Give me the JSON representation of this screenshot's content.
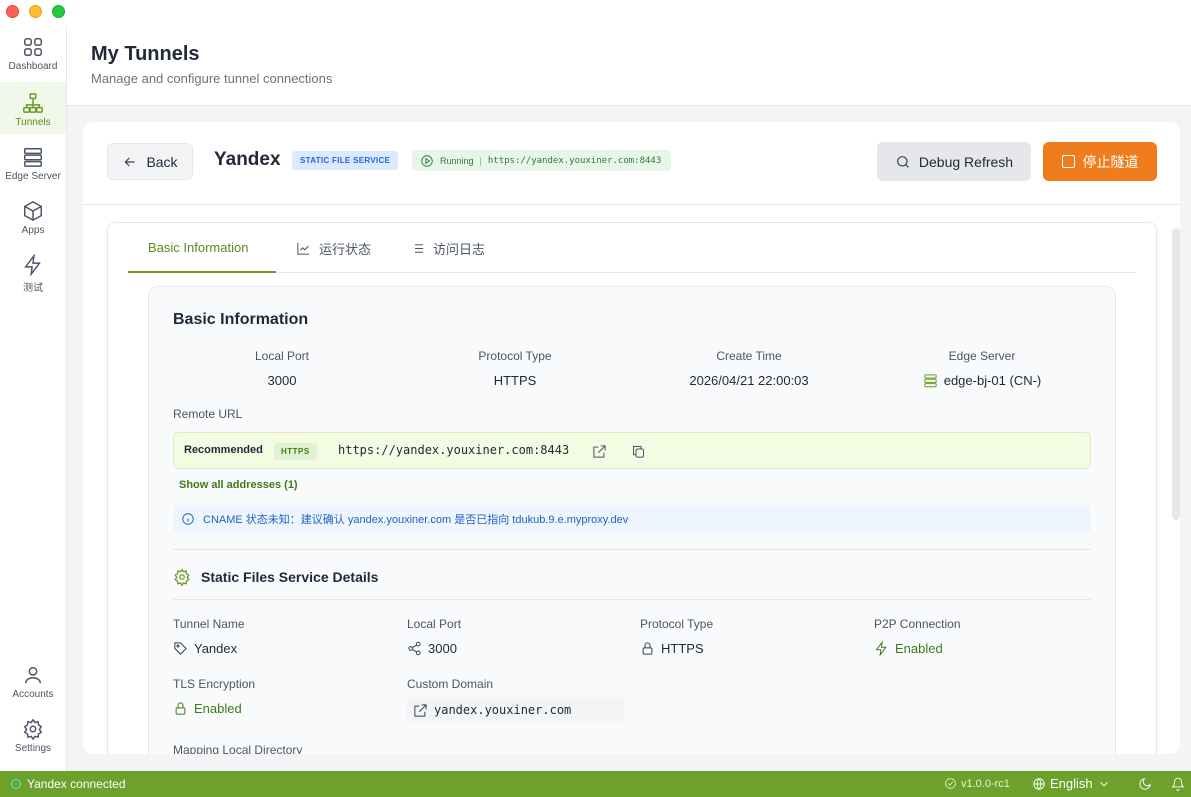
{
  "sidebar": {
    "items": [
      {
        "label": "Dashboard",
        "icon": "grid-icon"
      },
      {
        "label": "Tunnels",
        "icon": "network-icon"
      },
      {
        "label": "Edge Server",
        "icon": "server-icon"
      },
      {
        "label": "Apps",
        "icon": "box-icon"
      },
      {
        "label": "测试",
        "icon": "lightning-icon"
      }
    ],
    "bottom": [
      {
        "label": "Accounts",
        "icon": "user-icon"
      },
      {
        "label": "Settings",
        "icon": "gear-icon"
      }
    ]
  },
  "header": {
    "title": "My Tunnels",
    "subtitle": "Manage and configure tunnel connections"
  },
  "toolbar": {
    "back_label": "Back",
    "tunnel_name": "Yandex",
    "service_badge": "STATIC FILE SERVICE",
    "status_label": "Running",
    "status_sep": "|",
    "status_url": "https://yandex.youxiner.com:8443",
    "debug_label": "Debug Refresh",
    "stop_label": "停止隧道"
  },
  "tabs": [
    {
      "label": "Basic Information",
      "active": true
    },
    {
      "label": "运行状态",
      "active": false
    },
    {
      "label": "访问日志",
      "active": false
    }
  ],
  "basic": {
    "title": "Basic Information",
    "cols": [
      {
        "key": "Local Port",
        "value": "3000"
      },
      {
        "key": "Protocol Type",
        "value": "HTTPS"
      },
      {
        "key": "Create Time",
        "value": "2026/04/21 22:00:03"
      },
      {
        "key": "Edge Server",
        "value": "edge-bj-01 (CN-)"
      }
    ],
    "remote_label": "Remote URL",
    "recommended": "Recommended",
    "https_badge": "HTTPS",
    "remote_url": "https://yandex.youxiner.com:8443",
    "show_all": "Show all addresses (1)",
    "cname_note": "CNAME 状态未知：建议确认 yandex.youxiner.com 是否已指向 tdukub.9.e.myproxy.dev"
  },
  "details": {
    "title": "Static Files Service Details",
    "tunnel_name_key": "Tunnel Name",
    "tunnel_name_val": "Yandex",
    "local_port_key": "Local Port",
    "local_port_val": "3000",
    "protocol_key": "Protocol Type",
    "protocol_val": "HTTPS",
    "p2p_key": "P2P Connection",
    "p2p_val": "Enabled",
    "tls_key": "TLS Encryption",
    "tls_val": "Enabled",
    "domain_key": "Custom Domain",
    "domain_val": "yandex.youxiner.com",
    "mapping_key": "Mapping Local Directory"
  },
  "statusbar": {
    "connection": "Yandex connected",
    "version": "v1.0.0-rc1",
    "language": "English"
  },
  "colors": {
    "accent": "#6a9a23",
    "stop_button": "#f07d1d",
    "status_bar": "#6ca12b"
  }
}
